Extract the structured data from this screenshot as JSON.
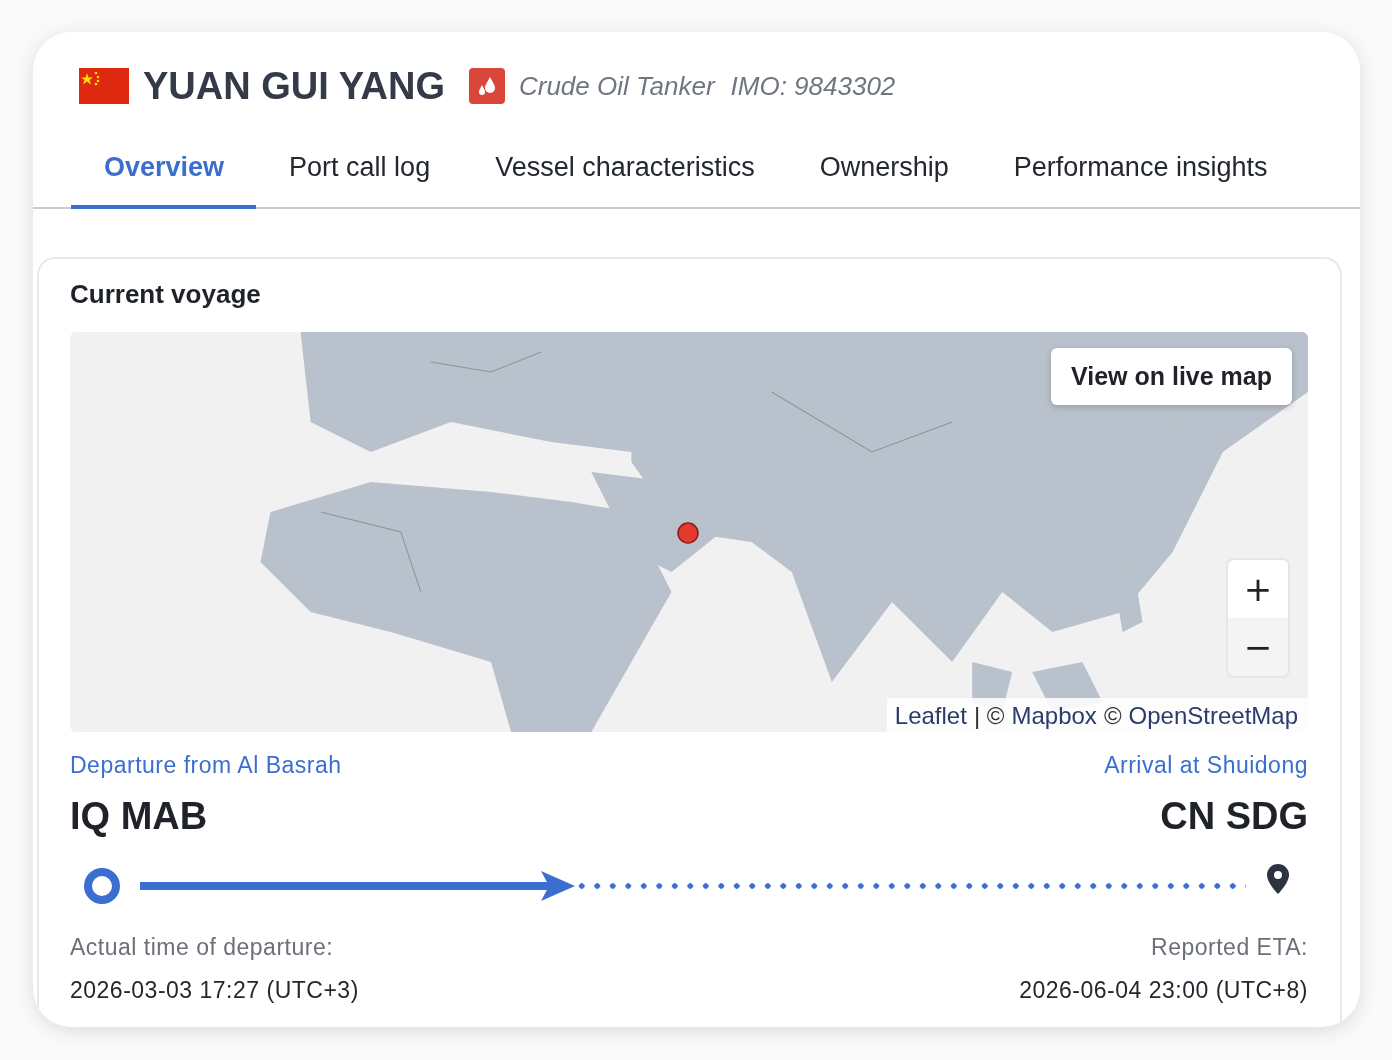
{
  "vessel": {
    "name": "YUAN GUI YANG",
    "type": "Crude Oil Tanker",
    "imo": "IMO: 9843302"
  },
  "tabs": [
    {
      "label": "Overview",
      "selected": true
    },
    {
      "label": "Port call log",
      "selected": false
    },
    {
      "label": "Vessel characteristics",
      "selected": false
    },
    {
      "label": "Ownership",
      "selected": false
    },
    {
      "label": "Performance insights",
      "selected": false
    }
  ],
  "voyage": {
    "title": "Current voyage",
    "map": {
      "kind": "picture",
      "live_map_button": "View on live map",
      "zoom_in": "+",
      "zoom_out": "−",
      "attribution": [
        {
          "kind": "link",
          "text": "Leaflet"
        },
        {
          "kind": "text",
          "text": "| ©"
        },
        {
          "kind": "link",
          "text": "Mapbox"
        },
        {
          "kind": "text",
          "text": "©"
        },
        {
          "kind": "link",
          "text": "OpenStreetMap"
        }
      ]
    },
    "departure": {
      "label": "Departure from Al Basrah",
      "code": "IQ MAB",
      "time_label": "Actual time of departure:",
      "time": "2026-03-03 17:27 (UTC+3)"
    },
    "arrival": {
      "label": "Arrival at Shuidong",
      "code": "CN SDG",
      "time_label": "Reported ETA:",
      "time": "2026-06-04 23:00 (UTC+8)"
    },
    "progress": {
      "level": 0.37
    }
  }
}
